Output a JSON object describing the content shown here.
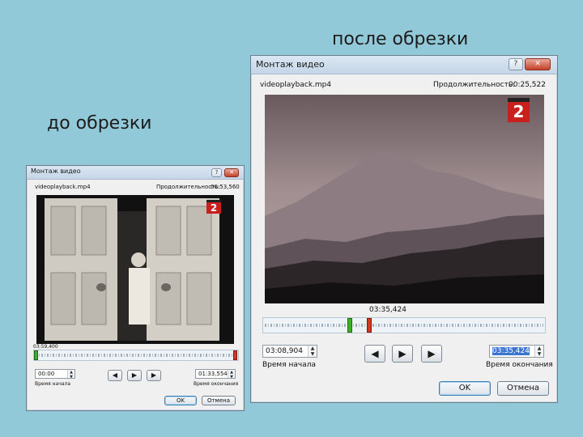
{
  "slide": {
    "after_label": "после обрезки",
    "before_label": "до обрезки"
  },
  "dialog_before": {
    "title": "Монтаж видео",
    "file_name": "videoplayback.mp4",
    "duration_label": "Продолжительность:",
    "duration_value": "00:53,560",
    "timeline_time": "03:59,400",
    "start_time": "00:00",
    "start_label": "Время начала",
    "end_time": "01:33,554",
    "end_label": "Время окончания",
    "ok_label": "OK",
    "cancel_label": "Отмена",
    "help_glyph": "?",
    "close_glyph": "✕",
    "channel_logo": "2"
  },
  "dialog_after": {
    "title": "Монтаж видео",
    "file_name": "videoplayback.mp4",
    "duration_label": "Продолжительность:",
    "duration_value": "00:25,522",
    "timeline_time": "03:35,424",
    "start_time": "03:08,904",
    "start_label": "Время начала",
    "end_time": "03:35,424",
    "end_label": "Время окончания",
    "ok_label": "OK",
    "cancel_label": "Отмена",
    "help_glyph": "?",
    "close_glyph": "✕",
    "channel_logo": "2"
  },
  "player_icons": {
    "prev": "previous-frame-icon",
    "play": "play-icon",
    "next": "next-frame-icon"
  },
  "colors": {
    "slide_background": "#92c9d8",
    "start_marker": "#3fae2a",
    "end_marker": "#d13a22",
    "channel_logo": "#c8201d"
  }
}
